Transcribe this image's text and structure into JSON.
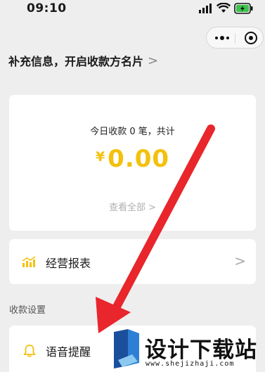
{
  "status_bar": {
    "time": "09:10",
    "icons": [
      "signal-icon",
      "wifi-icon",
      "battery-charging-icon"
    ]
  },
  "capsule": {
    "icons": [
      "more-icon",
      "close-mini-program-icon"
    ]
  },
  "profile_link": {
    "label": "补充信息，开启收款方名片",
    "chevron": ">"
  },
  "summary": {
    "today_label": "今日收款 0 笔，共计",
    "currency": "¥",
    "amount": "0.00",
    "view_all": "查看全部",
    "chevron": ">",
    "accent_color": "#f3c10c"
  },
  "report": {
    "label": "经营报表",
    "icon": "chart-icon",
    "chevron": ">"
  },
  "section": {
    "title": "收款设置"
  },
  "voice": {
    "label": "语音提醒",
    "icon": "bell-icon"
  },
  "annotation": {
    "color": "#e8262b",
    "icon": "arrow-icon"
  },
  "watermark": {
    "title": "设计下载站",
    "url": "www.shejizhaji.com"
  }
}
